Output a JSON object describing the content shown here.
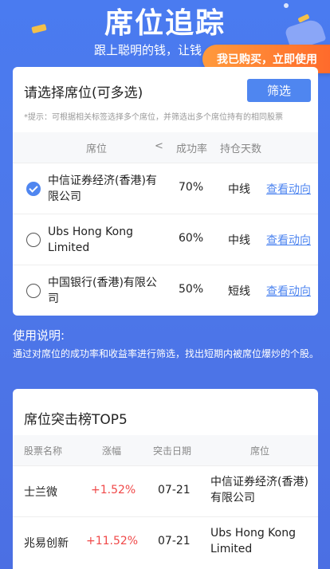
{
  "hero": {
    "title": "席位追踪",
    "subtitle": "跟上聪明的钱，让钱",
    "buy_label": "我已购买，立即使用"
  },
  "selector": {
    "title": "请选择席位(可多选)",
    "filter_label": "筛选",
    "hint": "*提示：可根据相关标签选择多个席位，并筛选出多个席位持有的相同股票",
    "columns": {
      "seat": "席位",
      "arrow": "<",
      "rate": "成功率",
      "days": "持仓天数"
    },
    "rows": [
      {
        "name": "中信证券经济(香港)有限公司",
        "rate": "70%",
        "days": "中线",
        "link": "查看动向",
        "checked": true
      },
      {
        "name": "Ubs Hong Kong Limited",
        "rate": "60%",
        "days": "中线",
        "link": "查看动向",
        "checked": false
      },
      {
        "name": "中国银行(香港)有限公司",
        "rate": "50%",
        "days": "短线",
        "link": "查看动向",
        "checked": false
      }
    ]
  },
  "usage": {
    "title": "使用说明:",
    "text": "通过对席位的成功率和收益率进行筛选，找出短期内被席位爆炒的个股。"
  },
  "top5": {
    "title": "席位突击榜TOP5",
    "columns": {
      "stock": "股票名称",
      "change": "涨幅",
      "date": "突击日期",
      "seat": "席位"
    },
    "rows": [
      {
        "stock": "士兰微",
        "change": "+1.52%",
        "date": "07-21",
        "seat": "中信证券经济(香港)有限公司"
      },
      {
        "stock": "兆易创新",
        "change": "+11.52%",
        "date": "07-21",
        "seat": "Ubs Hong Kong Limited"
      }
    ]
  },
  "colors": {
    "accent": "#4f86f0",
    "up": "#f04848",
    "orange": "#ff7a2f"
  }
}
